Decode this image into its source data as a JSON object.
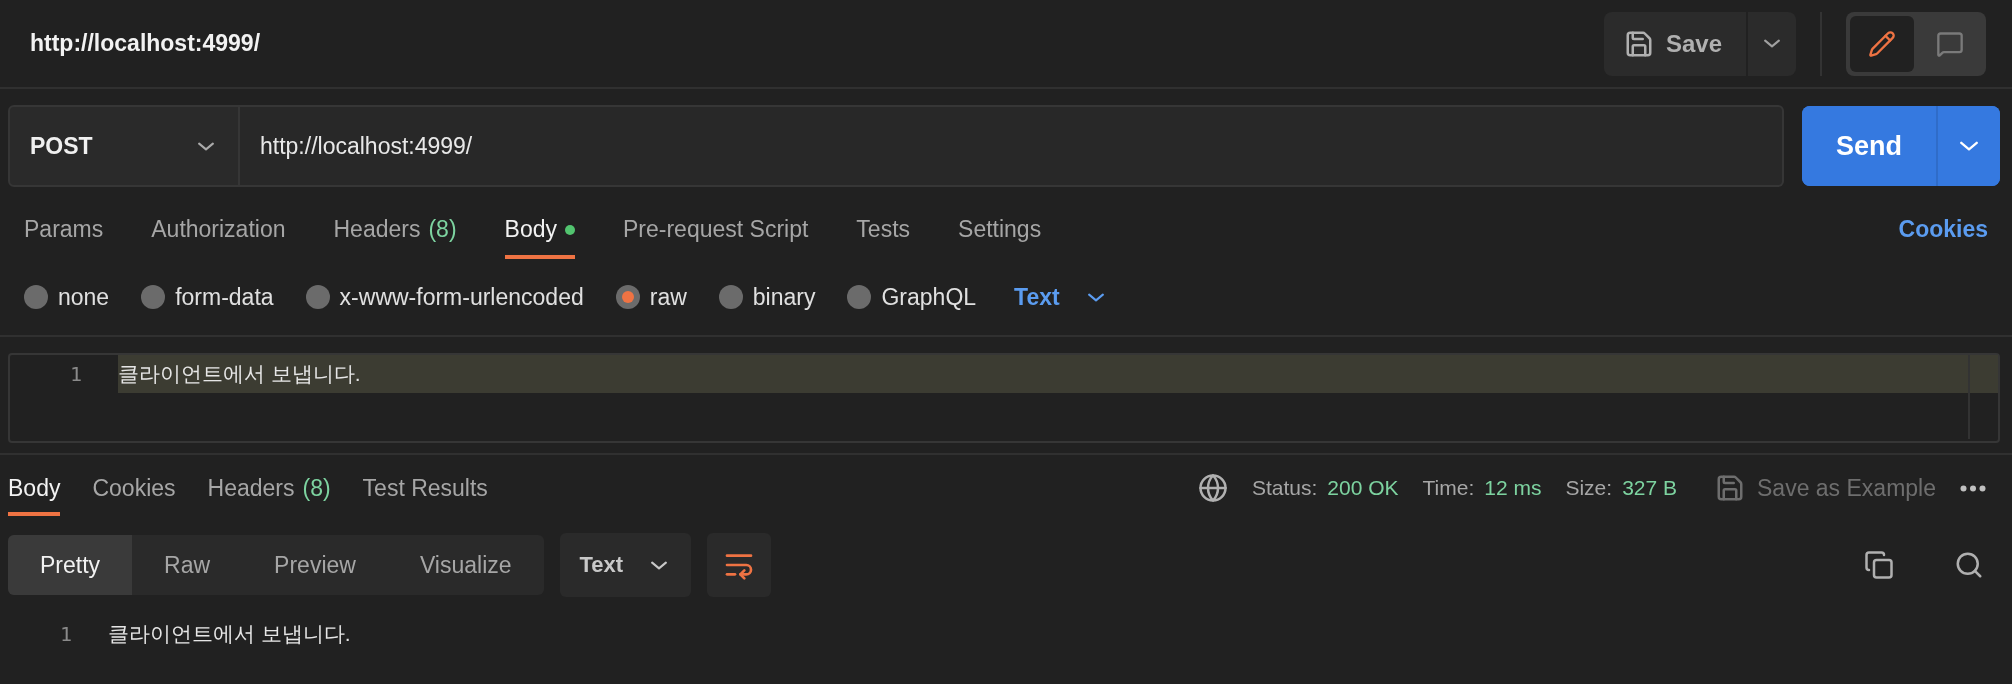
{
  "request_title": "http://localhost:4999/",
  "save_button": {
    "label": "Save"
  },
  "view_modes": [
    {
      "kind": "edit",
      "selected": true
    },
    {
      "kind": "comment",
      "selected": false
    }
  ],
  "method": "POST",
  "url": "http://localhost:4999/",
  "send_button": {
    "label": "Send"
  },
  "request_tabs": [
    {
      "label": "Params",
      "selected": false,
      "indicator": false
    },
    {
      "label": "Authorization",
      "selected": false,
      "indicator": false
    },
    {
      "label": "Headers",
      "count": "(8)",
      "selected": false,
      "indicator": false
    },
    {
      "label": "Body",
      "selected": true,
      "indicator": true
    },
    {
      "label": "Pre-request Script",
      "selected": false,
      "indicator": false
    },
    {
      "label": "Tests",
      "selected": false,
      "indicator": false
    },
    {
      "label": "Settings",
      "selected": false,
      "indicator": false
    }
  ],
  "cookies_link": "Cookies",
  "body_types": [
    {
      "label": "none",
      "selected": false
    },
    {
      "label": "form-data",
      "selected": false
    },
    {
      "label": "x-www-form-urlencoded",
      "selected": false
    },
    {
      "label": "raw",
      "selected": true
    },
    {
      "label": "binary",
      "selected": false
    },
    {
      "label": "GraphQL",
      "selected": false
    }
  ],
  "body_format": "Text",
  "request_lines": [
    {
      "number": "1",
      "text": "클라이언트에서 보냅니다.",
      "highlighted": true
    }
  ],
  "response_tabs": [
    {
      "label": "Body",
      "selected": true
    },
    {
      "label": "Cookies",
      "selected": false
    },
    {
      "label": "Headers",
      "count": "(8)",
      "selected": false
    },
    {
      "label": "Test Results",
      "selected": false
    }
  ],
  "response_meta": [
    {
      "label": "Status:",
      "value": "200 OK"
    },
    {
      "label": "Time:",
      "value": "12 ms"
    },
    {
      "label": "Size:",
      "value": "327 B"
    }
  ],
  "save_example": {
    "label": "Save as Example",
    "disabled": true
  },
  "view_tabs": [
    {
      "label": "Pretty",
      "selected": true
    },
    {
      "label": "Raw",
      "selected": false
    },
    {
      "label": "Preview",
      "selected": false
    },
    {
      "label": "Visualize",
      "selected": false
    }
  ],
  "response_format": "Text",
  "wrap_lines": {
    "on": true
  },
  "response_lines": [
    {
      "number": "1",
      "text": "클라이언트에서 보냅니다."
    }
  ]
}
